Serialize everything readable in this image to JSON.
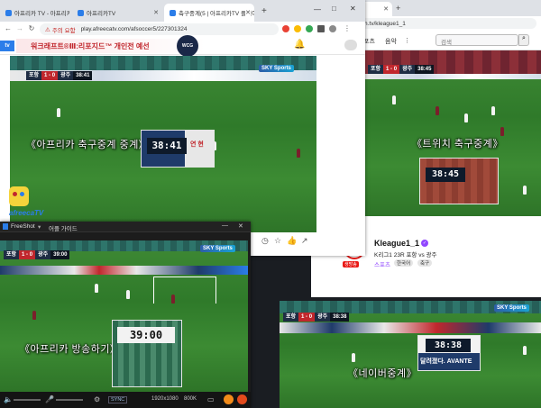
{
  "twitch_window": {
    "tab_title": "witch",
    "url": "twitch.tv/kleague1_1",
    "menu_items": [
      "포츠",
      "음악"
    ],
    "search_placeholder": "검색",
    "caption": "《트위치 축구중계》",
    "zoom_clock": "38:45",
    "scorebug": {
      "home": "포항",
      "score": "1 - 0",
      "away": "광주",
      "time": "38:45"
    },
    "channel": {
      "name": "Kleague1_1",
      "title": "K리그1 23R 포항 vs 광주",
      "category": "스포츠",
      "tags": [
        "한국어",
        "축구"
      ],
      "logo_text": "생방송"
    }
  },
  "afreeca_window": {
    "tabs": [
      {
        "title": "아프리카 TV - 아프리카TV",
        "color": "#2b7de9"
      },
      {
        "title": "아프리카TV",
        "color": "#2b7de9"
      },
      {
        "title": "축구중계(5 | 아프리카TV 플레이",
        "color": "#2b7de9"
      }
    ],
    "security_warning": "주의 요함",
    "url": "play.afreecatv.com/afsoccer5/227301324",
    "banner_text": "워크래프트®Ⅲ:리포지드™ 개인전 예선",
    "banner_badge": "WCG",
    "logo": "afreeca",
    "caption": "《아프리카 축구중계 중계》",
    "zoom_clock": "38:41",
    "zoom_clock_side": "연 현",
    "scorebug": {
      "home": "포항",
      "score": "1 - 0",
      "away": "광주",
      "time": "38:41"
    },
    "bottom_logo": "afreecaTV"
  },
  "freeshot_window": {
    "title": "FreeShot",
    "menu": "어플 가이드",
    "caption": "《아프리카 방송하기》",
    "zoom_clock": "39:00",
    "scorebug": {
      "home": "포항",
      "score": "1 - 0",
      "away": "광주",
      "time": "39:00"
    },
    "sync_label": "SYNC",
    "resolution": "1920x1080",
    "bitrate": "800K"
  },
  "naver_window": {
    "caption": "《네이버중계》",
    "zoom_clock": "38:38",
    "zoom_sub": "달려졌다. AVANTE",
    "scorebug": {
      "home": "포항",
      "score": "1 - 0",
      "away": "광주",
      "time": "38:38"
    }
  },
  "common": {
    "sky_sports": "SKY Sports"
  },
  "colors": {
    "twitch_purple": "#9147ff",
    "afreeca_blue": "#2b7de9",
    "scorebug_red": "#c1272d",
    "pitch_green": "#3a8a33"
  }
}
